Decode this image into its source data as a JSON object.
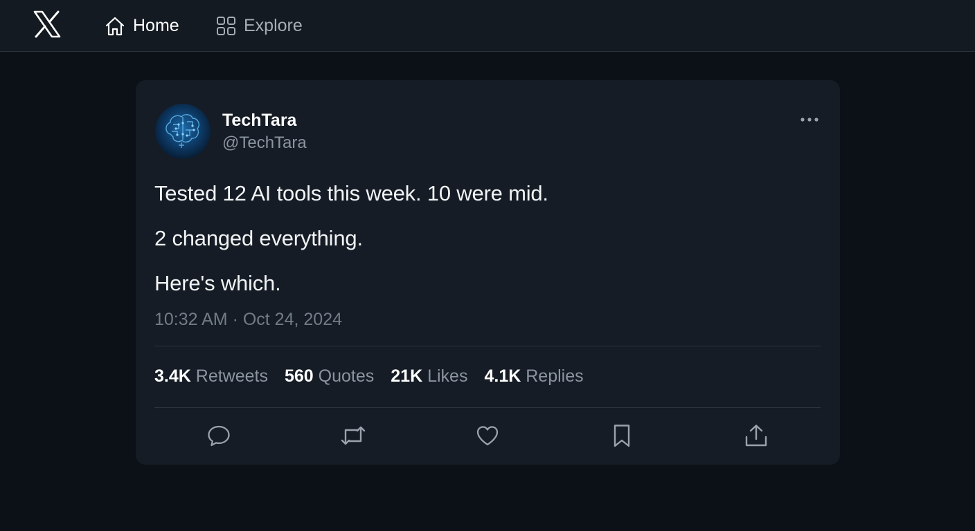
{
  "nav": {
    "logo_icon": "x-logo-icon",
    "home_label": "Home",
    "explore_label": "Explore"
  },
  "tweet": {
    "display_name": "TechTara",
    "handle": "@TechTara",
    "lines": [
      "Tested 12 AI tools this week. 10 were mid.",
      "2 changed everything.",
      "Here's which."
    ],
    "timestamp": "10:32 AM · Oct 24, 2024",
    "stats": {
      "retweets_count": "3.4K",
      "retweets_label": "Retweets",
      "quotes_count": "560",
      "quotes_label": "Quotes",
      "likes_count": "21K",
      "likes_label": "Likes",
      "replies_count": "4.1K",
      "replies_label": "Replies"
    },
    "actions": [
      "reply-icon",
      "retweet-icon",
      "like-icon",
      "bookmark-icon",
      "share-icon"
    ]
  },
  "colors": {
    "background": "#0c1117",
    "topbar": "#141a22",
    "card": "#151c25",
    "text_primary": "#ffffff",
    "text_secondary": "#8b95a0"
  }
}
